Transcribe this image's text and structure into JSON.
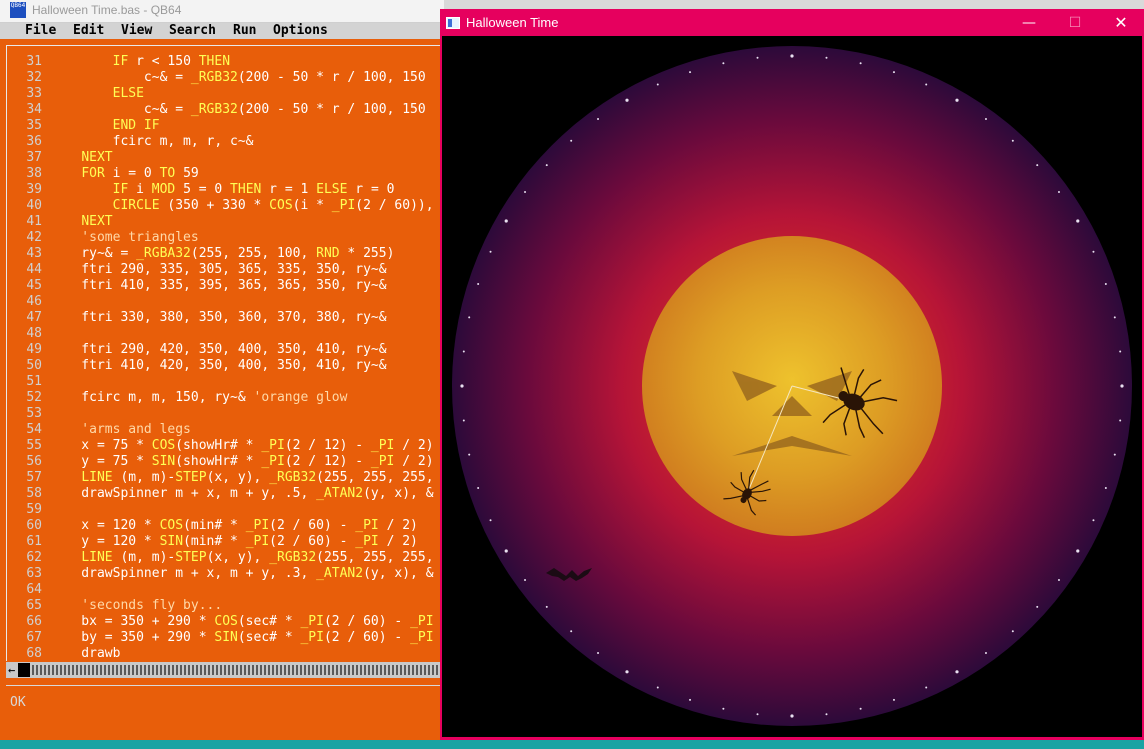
{
  "editor_window": {
    "title": "Halloween Time.bas - QB64",
    "app_icon_text": "QB64",
    "menu": [
      "File",
      "Edit",
      "View",
      "Search",
      "Run",
      "Options"
    ],
    "status": "OK",
    "hscroll_left_arrow": "←",
    "code": [
      {
        "n": "31",
        "segs": [
          [
            "        ",
            ""
          ],
          [
            "IF",
            "kw"
          ],
          [
            " r < 150 ",
            ""
          ],
          [
            "THEN",
            "kw"
          ]
        ]
      },
      {
        "n": "32",
        "segs": [
          [
            "            c~& = ",
            ""
          ],
          [
            "_RGB32",
            "kw"
          ],
          [
            "(200 - 50 * r / 100, 150",
            ""
          ]
        ]
      },
      {
        "n": "33",
        "segs": [
          [
            "        ",
            ""
          ],
          [
            "ELSE",
            "kw"
          ]
        ]
      },
      {
        "n": "34",
        "segs": [
          [
            "            c~& = ",
            ""
          ],
          [
            "_RGB32",
            "kw"
          ],
          [
            "(200 - 50 * r / 100, 150",
            ""
          ]
        ]
      },
      {
        "n": "35",
        "segs": [
          [
            "        ",
            ""
          ],
          [
            "END IF",
            "kw"
          ]
        ]
      },
      {
        "n": "36",
        "segs": [
          [
            "        fcirc m, m, r, c~&",
            ""
          ]
        ]
      },
      {
        "n": "37",
        "segs": [
          [
            "    ",
            ""
          ],
          [
            "NEXT",
            "kw"
          ]
        ]
      },
      {
        "n": "38",
        "segs": [
          [
            "    ",
            ""
          ],
          [
            "FOR",
            "kw"
          ],
          [
            " i = 0 ",
            ""
          ],
          [
            "TO",
            "kw"
          ],
          [
            " 59",
            ""
          ]
        ]
      },
      {
        "n": "39",
        "segs": [
          [
            "        ",
            ""
          ],
          [
            "IF",
            "kw"
          ],
          [
            " i ",
            ""
          ],
          [
            "MOD",
            "kw"
          ],
          [
            " 5 = 0 ",
            ""
          ],
          [
            "THEN",
            "kw"
          ],
          [
            " r = 1 ",
            ""
          ],
          [
            "ELSE",
            "kw"
          ],
          [
            " r = 0",
            ""
          ]
        ]
      },
      {
        "n": "40",
        "segs": [
          [
            "        ",
            ""
          ],
          [
            "CIRCLE",
            "kw"
          ],
          [
            " (350 + 330 * ",
            ""
          ],
          [
            "COS",
            "kw"
          ],
          [
            "(i * ",
            ""
          ],
          [
            "_PI",
            "kw"
          ],
          [
            "(2 / 60)),",
            ""
          ]
        ]
      },
      {
        "n": "41",
        "segs": [
          [
            "    ",
            ""
          ],
          [
            "NEXT",
            "kw"
          ]
        ]
      },
      {
        "n": "42",
        "segs": [
          [
            "    'some triangles",
            "cmt"
          ]
        ]
      },
      {
        "n": "43",
        "segs": [
          [
            "    ry~& = ",
            ""
          ],
          [
            "_RGBA32",
            "kw"
          ],
          [
            "(255, 255, 100, ",
            ""
          ],
          [
            "RND",
            "kw"
          ],
          [
            " * 255)",
            ""
          ]
        ]
      },
      {
        "n": "44",
        "segs": [
          [
            "    ftri 290, 335, 305, 365, 335, 350, ry~&",
            ""
          ]
        ]
      },
      {
        "n": "45",
        "segs": [
          [
            "    ftri 410, 335, 395, 365, 365, 350, ry~&",
            ""
          ]
        ]
      },
      {
        "n": "46",
        "segs": [
          [
            "",
            ""
          ]
        ]
      },
      {
        "n": "47",
        "segs": [
          [
            "    ftri 330, 380, 350, 360, 370, 380, ry~&",
            ""
          ]
        ]
      },
      {
        "n": "48",
        "segs": [
          [
            "",
            ""
          ]
        ]
      },
      {
        "n": "49",
        "segs": [
          [
            "    ftri 290, 420, 350, 400, 350, 410, ry~&",
            ""
          ]
        ]
      },
      {
        "n": "50",
        "segs": [
          [
            "    ftri 410, 420, 350, 400, 350, 410, ry~&",
            ""
          ]
        ]
      },
      {
        "n": "51",
        "segs": [
          [
            "",
            ""
          ]
        ]
      },
      {
        "n": "52",
        "segs": [
          [
            "    fcirc m, m, 150, ry~& ",
            ""
          ],
          [
            "'orange glow",
            "cmt"
          ]
        ]
      },
      {
        "n": "53",
        "segs": [
          [
            "",
            ""
          ]
        ]
      },
      {
        "n": "54",
        "segs": [
          [
            "    'arms and legs",
            "cmt"
          ]
        ]
      },
      {
        "n": "55",
        "segs": [
          [
            "    x = 75 * ",
            ""
          ],
          [
            "COS",
            "kw"
          ],
          [
            "(showHr# * ",
            ""
          ],
          [
            "_PI",
            "kw"
          ],
          [
            "(2 / 12) - ",
            ""
          ],
          [
            "_PI",
            "kw"
          ],
          [
            " / 2)",
            ""
          ]
        ]
      },
      {
        "n": "56",
        "segs": [
          [
            "    y = 75 * ",
            ""
          ],
          [
            "SIN",
            "kw"
          ],
          [
            "(showHr# * ",
            ""
          ],
          [
            "_PI",
            "kw"
          ],
          [
            "(2 / 12) - ",
            ""
          ],
          [
            "_PI",
            "kw"
          ],
          [
            " / 2)",
            ""
          ]
        ]
      },
      {
        "n": "57",
        "segs": [
          [
            "    ",
            ""
          ],
          [
            "LINE",
            "kw"
          ],
          [
            " (m, m)-",
            ""
          ],
          [
            "STEP",
            "kw"
          ],
          [
            "(x, y), ",
            ""
          ],
          [
            "_RGB32",
            "kw"
          ],
          [
            "(255, 255, 255,",
            ""
          ]
        ]
      },
      {
        "n": "58",
        "segs": [
          [
            "    drawSpinner m + x, m + y, .5, ",
            ""
          ],
          [
            "_ATAN2",
            "kw"
          ],
          [
            "(y, x), &",
            ""
          ]
        ]
      },
      {
        "n": "59",
        "segs": [
          [
            "",
            ""
          ]
        ]
      },
      {
        "n": "60",
        "segs": [
          [
            "    x = 120 * ",
            ""
          ],
          [
            "COS",
            "kw"
          ],
          [
            "(min# * ",
            ""
          ],
          [
            "_PI",
            "kw"
          ],
          [
            "(2 / 60) - ",
            ""
          ],
          [
            "_PI",
            "kw"
          ],
          [
            " / 2)",
            ""
          ]
        ]
      },
      {
        "n": "61",
        "segs": [
          [
            "    y = 120 * ",
            ""
          ],
          [
            "SIN",
            "kw"
          ],
          [
            "(min# * ",
            ""
          ],
          [
            "_PI",
            "kw"
          ],
          [
            "(2 / 60) - ",
            ""
          ],
          [
            "_PI",
            "kw"
          ],
          [
            " / 2)",
            ""
          ]
        ]
      },
      {
        "n": "62",
        "segs": [
          [
            "    ",
            ""
          ],
          [
            "LINE",
            "kw"
          ],
          [
            " (m, m)-",
            ""
          ],
          [
            "STEP",
            "kw"
          ],
          [
            "(x, y), ",
            ""
          ],
          [
            "_RGB32",
            "kw"
          ],
          [
            "(255, 255, 255,",
            ""
          ]
        ]
      },
      {
        "n": "63",
        "segs": [
          [
            "    drawSpinner m + x, m + y, .3, ",
            ""
          ],
          [
            "_ATAN2",
            "kw"
          ],
          [
            "(y, x), &",
            ""
          ]
        ]
      },
      {
        "n": "64",
        "segs": [
          [
            "",
            ""
          ]
        ]
      },
      {
        "n": "65",
        "segs": [
          [
            "    'seconds fly by...",
            "cmt"
          ]
        ]
      },
      {
        "n": "66",
        "segs": [
          [
            "    bx = 350 + 290 * ",
            ""
          ],
          [
            "COS",
            "kw"
          ],
          [
            "(sec# * ",
            ""
          ],
          [
            "_PI",
            "kw"
          ],
          [
            "(2 / 60) - ",
            ""
          ],
          [
            "_PI",
            "kw"
          ]
        ]
      },
      {
        "n": "67",
        "segs": [
          [
            "    by = 350 + 290 * ",
            ""
          ],
          [
            "SIN",
            "kw"
          ],
          [
            "(sec# * ",
            ""
          ],
          [
            "_PI",
            "kw"
          ],
          [
            "(2 / 60) - ",
            ""
          ],
          [
            "_PI",
            "kw"
          ]
        ]
      },
      {
        "n": "68",
        "segs": [
          [
            "    drawb",
            ""
          ]
        ]
      }
    ]
  },
  "output_window": {
    "title": "Halloween Time",
    "minimize_glyph": "—",
    "maximize_glyph": "☐",
    "close_glyph": "✕"
  },
  "colors": {
    "editor_bg": "#e85e0a",
    "keyword": "#ffff55",
    "output_titlebar": "#e6005e"
  }
}
